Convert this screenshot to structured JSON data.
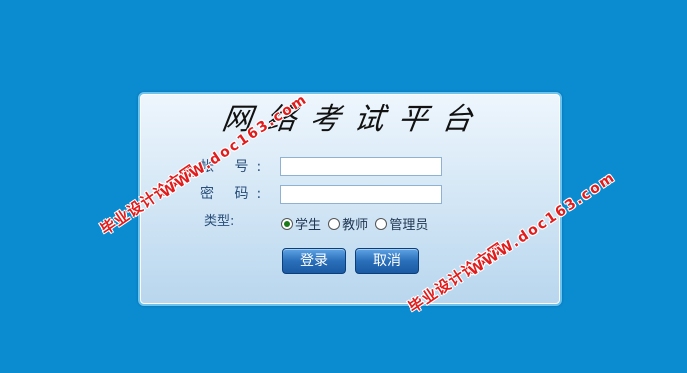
{
  "login": {
    "title": "网络考试平台",
    "account_label": "帐 号:",
    "password_label": "密 码:",
    "account_value": "",
    "password_value": "",
    "type_label": "类型:",
    "roles": [
      {
        "label": "学生",
        "checked": true
      },
      {
        "label": "教师",
        "checked": false
      },
      {
        "label": "管理员",
        "checked": false
      }
    ],
    "login_button": "登录",
    "cancel_button": "取消"
  },
  "watermark": {
    "site_name": "毕业设计论文网",
    "url": "WWW.doc163.com"
  },
  "colors": {
    "background": "#0b8bd0",
    "panel_top": "#eef6fd",
    "panel_bottom": "#b8d6ee",
    "button": "#2a6fba",
    "watermark": "#e21c1c"
  }
}
